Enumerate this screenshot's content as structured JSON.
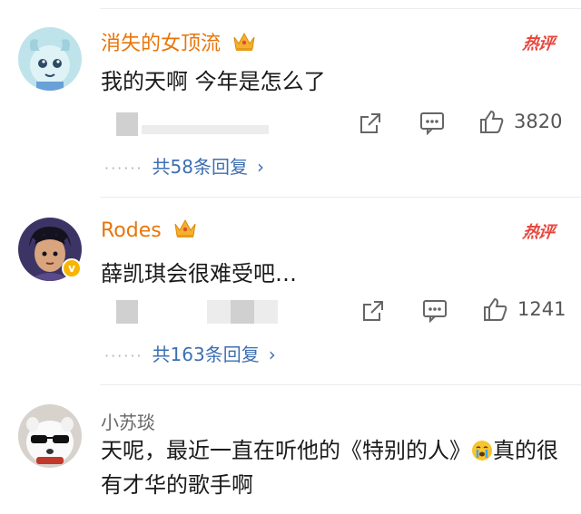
{
  "comments": [
    {
      "username": "消失的女顶流",
      "text": "我的天啊 今年是怎么了",
      "hot_label": "热评",
      "likes": "3820",
      "replies_label": "共58条回复"
    },
    {
      "username": "Rodes",
      "text": "薛凯琪会很难受吧…",
      "hot_label": "热评",
      "likes": "1241",
      "replies_label": "共163条回复"
    },
    {
      "username": "小苏琰",
      "text_part1": "天呢，最近一直在听他的《特别的人》",
      "text_part2": "真的很有才华的歌手啊"
    }
  ],
  "icons": {
    "crown": "crown-icon",
    "share": "share-icon",
    "comment": "comment-icon",
    "like": "thumbs-up-icon",
    "emoji": "crying-face-icon",
    "verified": "verified-badge-icon"
  },
  "colors": {
    "vip_name": "#e8750a",
    "hot": "#e8463c",
    "link": "#3d6fb3",
    "text": "#1a1a1a",
    "muted": "#666666"
  }
}
